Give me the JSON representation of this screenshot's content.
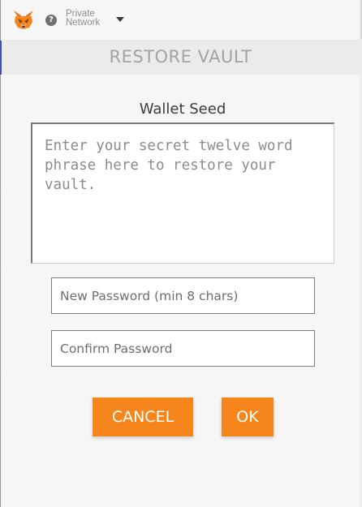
{
  "header": {
    "logo_icon": "metamask-fox-icon",
    "help_icon": "question-mark-icon",
    "help_glyph": "?",
    "network": {
      "line1": "Private",
      "line2": "Network",
      "caret_icon": "chevron-down-icon"
    }
  },
  "title": "RESTORE VAULT",
  "seed": {
    "label": "Wallet Seed",
    "placeholder": "Enter your secret twelve word phrase here to restore your vault.",
    "value": ""
  },
  "password": {
    "placeholder": "New Password (min 8 chars)",
    "value": ""
  },
  "confirm": {
    "placeholder": "Confirm Password",
    "value": ""
  },
  "buttons": {
    "cancel": "CANCEL",
    "ok": "OK"
  },
  "colors": {
    "accent": "#f6851b",
    "background": "#f6f6f6",
    "title_bar": "#ebebeb",
    "title_text": "#a3a3a3"
  }
}
